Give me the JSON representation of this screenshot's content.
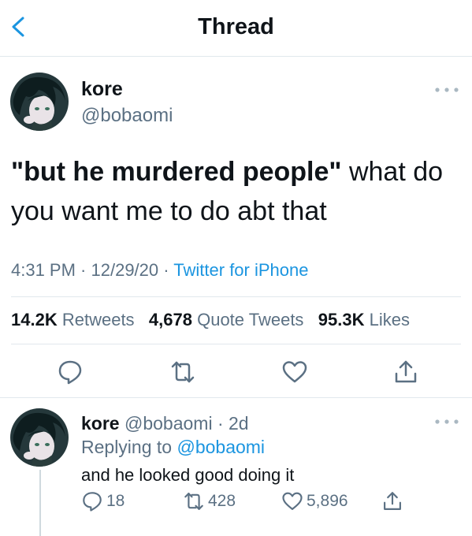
{
  "header": {
    "title": "Thread",
    "back_icon": "chevron-left-icon",
    "accent": "#1b95e0"
  },
  "main_tweet": {
    "author_name": "kore",
    "author_handle": "@bobaomi",
    "text_quoted": "\"but he murdered people\"",
    "text_rest": " what do you want me to do abt that",
    "time": "4:31 PM",
    "date": "12/29/20",
    "sep": " · ",
    "source": "Twitter for iPhone",
    "stats": {
      "retweets_count": "14.2K",
      "retweets_label": "Retweets",
      "quotes_count": "4,678",
      "quotes_label": "Quote Tweets",
      "likes_count": "95.3K",
      "likes_label": "Likes"
    },
    "actions": [
      "reply-icon",
      "retweet-icon",
      "like-icon",
      "share-icon"
    ]
  },
  "reply_tweet": {
    "author_name": "kore",
    "author_handle": "@bobaomi",
    "time_ago": "· 2d",
    "replying_prefix": "Replying to",
    "replying_to": "@bobaomi",
    "text": "and he looked good doing it",
    "reply_count": "18",
    "retweet_count": "428",
    "like_count": "5,896"
  }
}
